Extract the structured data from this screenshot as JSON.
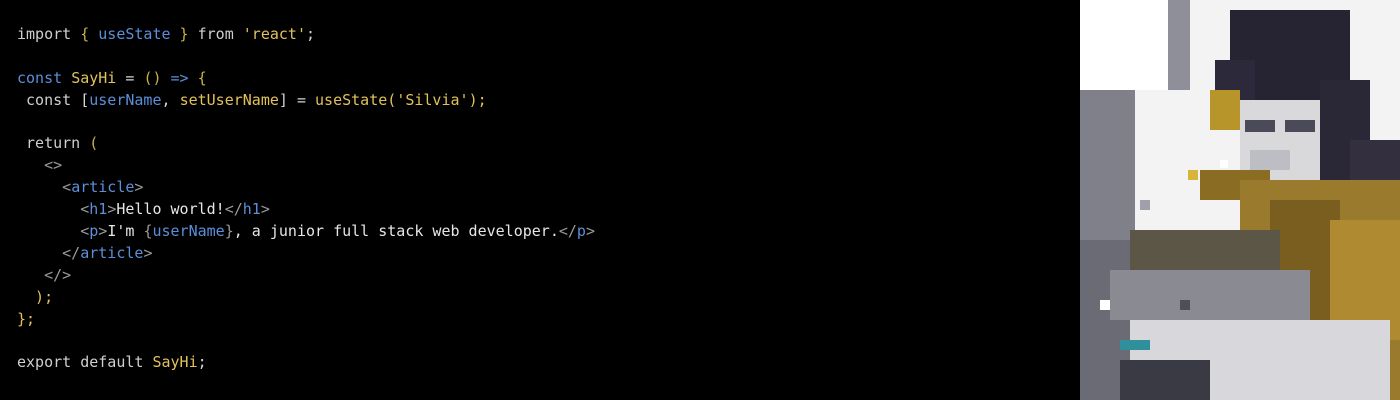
{
  "code_lines": [
    [
      {
        "t": "import ",
        "c": "t-kw"
      },
      {
        "t": "{ ",
        "c": "t-punct"
      },
      {
        "t": "useState",
        "c": "t-blue"
      },
      {
        "t": " } ",
        "c": "t-punct"
      },
      {
        "t": "from ",
        "c": "t-kw"
      },
      {
        "t": "'react'",
        "c": "t-string"
      },
      {
        "t": ";",
        "c": "t-plain"
      }
    ],
    [],
    [
      {
        "t": "const ",
        "c": "t-blue"
      },
      {
        "t": "SayHi",
        "c": "t-yellow"
      },
      {
        "t": " = ",
        "c": "t-plain"
      },
      {
        "t": "()",
        "c": "t-punct"
      },
      {
        "t": " => ",
        "c": "t-blue"
      },
      {
        "t": "{",
        "c": "t-punct"
      }
    ],
    [
      {
        "t": " const ",
        "c": "t-kw"
      },
      {
        "t": "[",
        "c": "t-plain"
      },
      {
        "t": "userName",
        "c": "t-blue"
      },
      {
        "t": ", ",
        "c": "t-plain"
      },
      {
        "t": "setUserName",
        "c": "t-yellow"
      },
      {
        "t": "] = ",
        "c": "t-plain"
      },
      {
        "t": "useState(",
        "c": "t-yellow"
      },
      {
        "t": "'Silvia'",
        "c": "t-string"
      },
      {
        "t": ");",
        "c": "t-yellow"
      }
    ],
    [],
    [
      {
        "t": " return ",
        "c": "t-kw"
      },
      {
        "t": "(",
        "c": "t-punct"
      }
    ],
    [
      {
        "t": "   <>",
        "c": "t-dim"
      }
    ],
    [
      {
        "t": "     <",
        "c": "t-dim"
      },
      {
        "t": "article",
        "c": "t-blue"
      },
      {
        "t": ">",
        "c": "t-dim"
      }
    ],
    [
      {
        "t": "       <",
        "c": "t-dim"
      },
      {
        "t": "h1",
        "c": "t-blue"
      },
      {
        "t": ">",
        "c": "t-dim"
      },
      {
        "t": "Hello world!",
        "c": "t-text"
      },
      {
        "t": "</",
        "c": "t-dim"
      },
      {
        "t": "h1",
        "c": "t-blue"
      },
      {
        "t": ">",
        "c": "t-dim"
      }
    ],
    [
      {
        "t": "       <",
        "c": "t-dim"
      },
      {
        "t": "p",
        "c": "t-blue"
      },
      {
        "t": ">",
        "c": "t-dim"
      },
      {
        "t": "I'm ",
        "c": "t-text"
      },
      {
        "t": "{",
        "c": "t-dim"
      },
      {
        "t": "userName",
        "c": "t-blue"
      },
      {
        "t": "}",
        "c": "t-dim"
      },
      {
        "t": ", a junior full stack web developer.",
        "c": "t-text"
      },
      {
        "t": "</",
        "c": "t-dim"
      },
      {
        "t": "p",
        "c": "t-blue"
      },
      {
        "t": ">",
        "c": "t-dim"
      }
    ],
    [
      {
        "t": "     </",
        "c": "t-dim"
      },
      {
        "t": "article",
        "c": "t-blue"
      },
      {
        "t": ">",
        "c": "t-dim"
      }
    ],
    [
      {
        "t": "   </>",
        "c": "t-dim"
      }
    ],
    [
      {
        "t": "  );",
        "c": "t-yellow"
      }
    ],
    [
      {
        "t": "};",
        "c": "t-yellow"
      }
    ],
    [],
    [
      {
        "t": "export default ",
        "c": "t-kw"
      },
      {
        "t": "SayHi",
        "c": "t-yellow"
      },
      {
        "t": ";",
        "c": "t-plain"
      }
    ]
  ],
  "colors": {
    "background": "#000000",
    "keyword": "#cfcfcf",
    "identifier_blue": "#5b8fd9",
    "identifier_yellow": "#e2c25b",
    "tag_punct": "#9a9a9a"
  },
  "illustration": {
    "icon": "pixel-art-developer-icon"
  }
}
